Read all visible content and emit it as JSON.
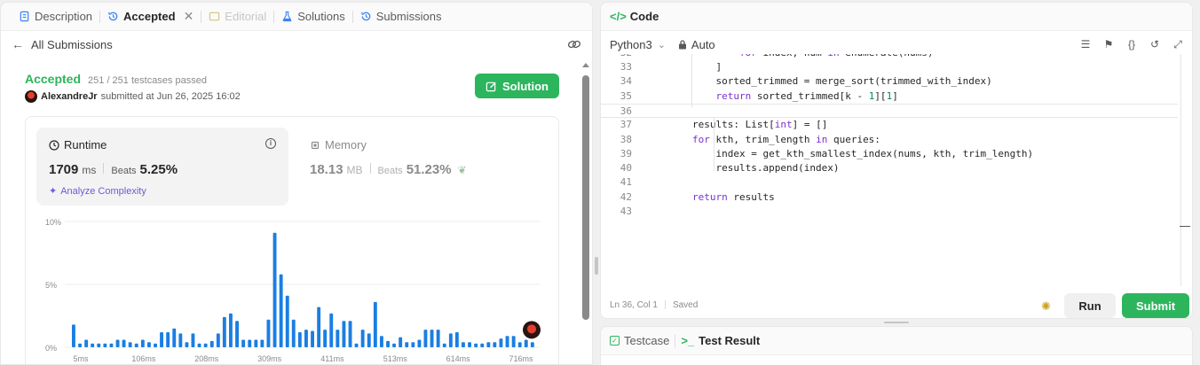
{
  "tabs": [
    {
      "label": "Description",
      "icon": "description-icon"
    },
    {
      "label": "Accepted",
      "icon": "history-icon",
      "active": true
    },
    {
      "label": "Editorial",
      "icon": "editorial-icon",
      "disabled": true
    },
    {
      "label": "Solutions",
      "icon": "flask-icon"
    },
    {
      "label": "Submissions",
      "icon": "history-icon"
    }
  ],
  "subheader": {
    "back_label": "All Submissions"
  },
  "submission": {
    "status": "Accepted",
    "testcases": "251 / 251 testcases passed",
    "author": "AlexandreJr",
    "submitted_text": "submitted at Jun 26, 2025 16:02",
    "solution_button": "Solution"
  },
  "runtime": {
    "title": "Runtime",
    "value": "1709",
    "unit": "ms",
    "beats_label": "Beats",
    "beats_pct": "5.25%",
    "analyze_label": "Analyze Complexity"
  },
  "memory": {
    "title": "Memory",
    "value": "18.13",
    "unit": "MB",
    "beats_label": "Beats",
    "beats_pct": "51.23%"
  },
  "chart_data": {
    "type": "bar",
    "ytick_labels": [
      "10%",
      "5%",
      "0%"
    ],
    "ylim": [
      0,
      10
    ],
    "xtick_labels": [
      "5ms",
      "106ms",
      "208ms",
      "309ms",
      "411ms",
      "513ms",
      "614ms",
      "716ms"
    ],
    "values": [
      1.8,
      0.3,
      0.6,
      0.3,
      0.3,
      0.3,
      0.3,
      0.6,
      0.6,
      0.4,
      0.3,
      0.6,
      0.4,
      0.3,
      1.2,
      1.2,
      1.5,
      1.1,
      0.4,
      1.1,
      0.3,
      0.3,
      0.5,
      1.1,
      2.4,
      2.7,
      2.1,
      0.6,
      0.6,
      0.6,
      0.6,
      2.2,
      9.1,
      5.8,
      4.1,
      2.2,
      1.2,
      1.4,
      1.3,
      3.2,
      1.4,
      2.7,
      1.4,
      2.1,
      2.1,
      0.3,
      1.4,
      1.1,
      3.6,
      0.9,
      0.5,
      0.3,
      0.8,
      0.4,
      0.4,
      0.6,
      1.4,
      1.4,
      1.4,
      0.3,
      1.1,
      1.2,
      0.4,
      0.4,
      0.3,
      0.3,
      0.4,
      0.4,
      0.7,
      0.9,
      0.9,
      0.4,
      0.6,
      0.4
    ],
    "grid": true,
    "color": "#1a7ee3"
  },
  "code_panel": {
    "title": "Code",
    "language": "Python3",
    "mode": "Auto",
    "status_position": "Ln 36, Col 1",
    "status_saved": "Saved",
    "run_label": "Run",
    "submit_label": "Submit"
  },
  "code_lines": [
    {
      "n": "33",
      "t": "            ]"
    },
    {
      "n": "34",
      "t": "            sorted_trimmed = merge_sort(trimmed_with_index)"
    },
    {
      "n": "35",
      "t": "            return sorted_trimmed[k - 1][1]"
    },
    {
      "n": "36",
      "t": ""
    },
    {
      "n": "37",
      "t": "        results: List[int] = []"
    },
    {
      "n": "38",
      "t": "        for kth, trim_length in queries:"
    },
    {
      "n": "39",
      "t": "            index = get_kth_smallest_index(nums, kth, trim_length)"
    },
    {
      "n": "40",
      "t": "            results.append(index)"
    },
    {
      "n": "41",
      "t": ""
    },
    {
      "n": "42",
      "t": "        return results"
    },
    {
      "n": "43",
      "t": ""
    }
  ],
  "bottom_tabs": [
    {
      "label": "Testcase",
      "icon": "checkbox-icon"
    },
    {
      "label": "Test Result",
      "icon": "terminal-icon",
      "active": true
    }
  ]
}
